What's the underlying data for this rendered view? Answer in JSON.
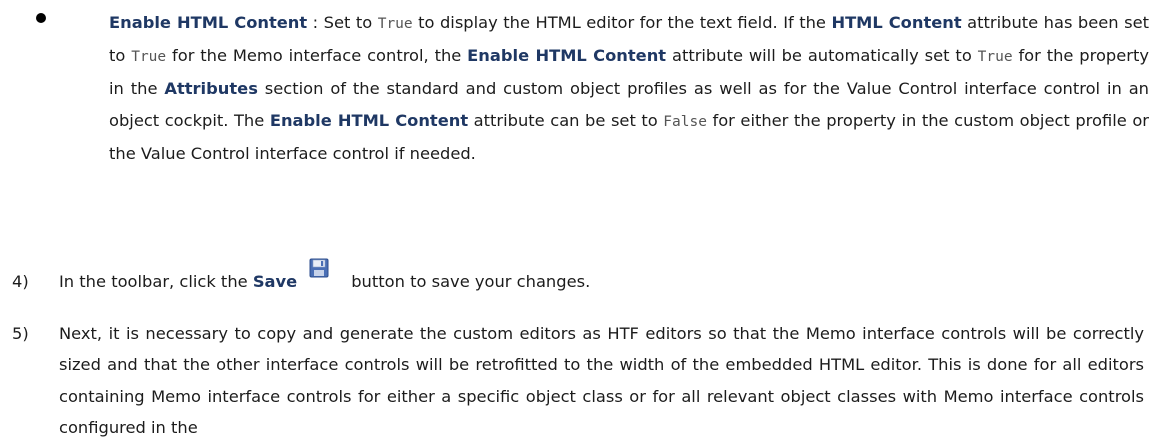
{
  "bullet": {
    "term": "Enable HTML Content",
    "t1": " : Set to ",
    "c1": "True",
    "t2": " to display the HTML editor for the text field. If the ",
    "b2": "HTML Content",
    "t3": " attribute has been set to ",
    "c2": "True",
    "t4": " for the Memo interface control, the ",
    "b3": "Enable HTML Content",
    "t5": " attribute will be automatically set to ",
    "c3": "True",
    "t6": " for the property in the ",
    "b4": "Attributes",
    "t7": " section of the standard and custom object profiles as well as for the Value Control interface control in an object cockpit. The ",
    "b5": "Enable HTML Content",
    "t8": " attribute can be set to ",
    "c4": "False",
    "t9": " for either the property in the custom object profile or the Value Control interface control if needed."
  },
  "step4": {
    "number": "4)",
    "pre": "In the toolbar, click the ",
    "save_label": "Save",
    "icon": "save-floppy-icon",
    "post": "button to save your changes."
  },
  "step5": {
    "number": "5)",
    "text": "Next, it is necessary to copy and generate the custom editors as HTF editors so that the Memo interface controls will be correctly sized and that the other interface controls will be retrofitted to the width of the embedded HTML editor. This is done for all editors containing Memo interface controls for either a specific object class or for all relevant object classes with Memo interface controls configured in the"
  },
  "colors": {
    "bold_label": "#1f3864",
    "body_text": "#1c1c1c",
    "code_text": "#555555"
  }
}
